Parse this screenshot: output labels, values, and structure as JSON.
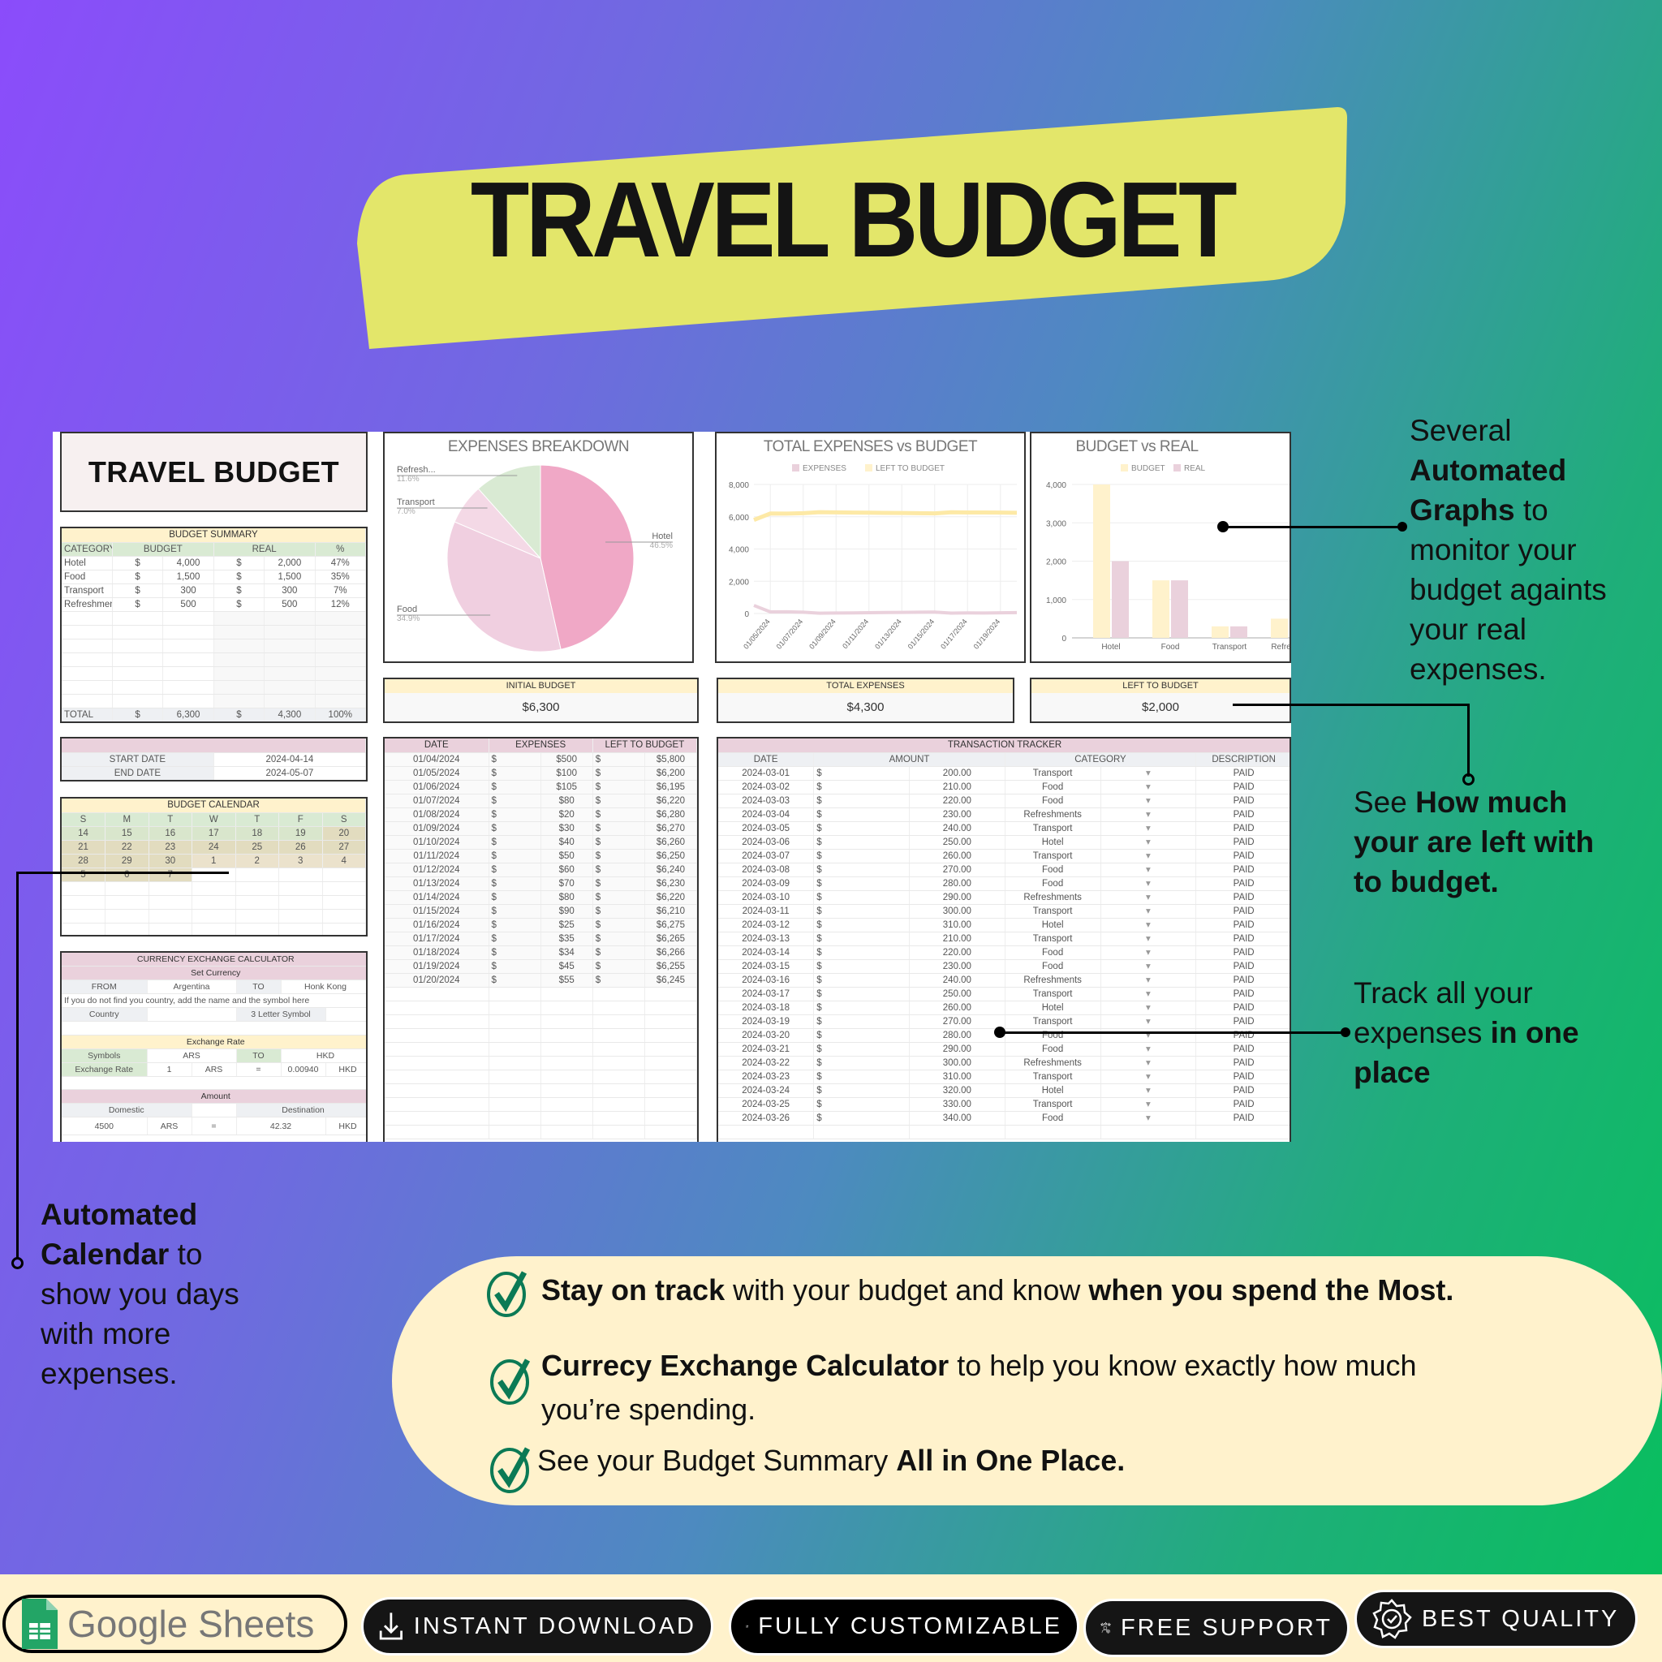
{
  "hero": {
    "title": "TRAVEL BUDGET",
    "banner_color": "#e3e66a"
  },
  "sheet": {
    "title": "TRAVEL BUDGET",
    "summary": {
      "header": "BUDGET SUMMARY",
      "columns": [
        "CATEGORY",
        "BUDGET",
        "REAL",
        "%"
      ],
      "rows": [
        [
          "Hotel",
          "$",
          "4,000",
          "$",
          "2,000",
          "47%"
        ],
        [
          "Food",
          "$",
          "1,500",
          "$",
          "1,500",
          "35%"
        ],
        [
          "Transport",
          "$",
          "300",
          "$",
          "300",
          "7%"
        ],
        [
          "Refreshments",
          "$",
          "500",
          "$",
          "500",
          "12%"
        ]
      ],
      "total": [
        "TOTAL",
        "$",
        "6,300",
        "$",
        "4,300",
        "100%"
      ]
    },
    "dates": {
      "start_label": "START DATE",
      "start": "2024-04-14",
      "end_label": "END DATE",
      "end": "2024-05-07"
    },
    "calendar": {
      "header": "BUDGET CALENDAR",
      "days": [
        "S",
        "M",
        "T",
        "W",
        "T",
        "F",
        "S"
      ],
      "weeks": [
        [
          "14",
          "15",
          "16",
          "17",
          "18",
          "19",
          "20"
        ],
        [
          "21",
          "22",
          "23",
          "24",
          "25",
          "26",
          "27"
        ],
        [
          "28",
          "29",
          "30",
          "1",
          "2",
          "3",
          "4"
        ],
        [
          "5",
          "6",
          "7",
          "",
          "",
          "",
          ""
        ]
      ]
    },
    "currency": {
      "header": "CURRENCY EXCHANGE CALCULATOR",
      "set_currency": "Set Currency",
      "from_label": "FROM",
      "from": "Argentina",
      "to_label": "TO",
      "to": "Honk Kong",
      "note": "If you do not find you country, add the name and the symbol here",
      "country_label": "Country",
      "symbol_label": "3 Letter Symbol",
      "rate_header": "Exchange Rate",
      "symbols_label": "Symbols",
      "from_symbol": "ARS",
      "to_symbol": "HKD",
      "rate_label": "Exchange Rate",
      "rate_one": "1",
      "equals": "=",
      "rate_value": "0.00940",
      "amount_header": "Amount",
      "domestic_label": "Domestic",
      "destination_label": "Destination",
      "domestic_value": "4500",
      "destination_value": "42.32"
    },
    "kpis": [
      {
        "label": "INITIAL BUDGET",
        "value": "$6,300"
      },
      {
        "label": "TOTAL EXPENSES",
        "value": "$4,300"
      },
      {
        "label": "LEFT TO BUDGET",
        "value": "$2,000"
      }
    ],
    "expenses": {
      "columns": [
        "DATE",
        "EXPENSES",
        "LEFT TO BUDGET"
      ],
      "rows": [
        [
          "01/04/2024",
          "$",
          "$500",
          "$",
          "$5,800"
        ],
        [
          "01/05/2024",
          "$",
          "$100",
          "$",
          "$6,200"
        ],
        [
          "01/06/2024",
          "$",
          "$105",
          "$",
          "$6,195"
        ],
        [
          "01/07/2024",
          "$",
          "$80",
          "$",
          "$6,220"
        ],
        [
          "01/08/2024",
          "$",
          "$20",
          "$",
          "$6,280"
        ],
        [
          "01/09/2024",
          "$",
          "$30",
          "$",
          "$6,270"
        ],
        [
          "01/10/2024",
          "$",
          "$40",
          "$",
          "$6,260"
        ],
        [
          "01/11/2024",
          "$",
          "$50",
          "$",
          "$6,250"
        ],
        [
          "01/12/2024",
          "$",
          "$60",
          "$",
          "$6,240"
        ],
        [
          "01/13/2024",
          "$",
          "$70",
          "$",
          "$6,230"
        ],
        [
          "01/14/2024",
          "$",
          "$80",
          "$",
          "$6,220"
        ],
        [
          "01/15/2024",
          "$",
          "$90",
          "$",
          "$6,210"
        ],
        [
          "01/16/2024",
          "$",
          "$25",
          "$",
          "$6,275"
        ],
        [
          "01/17/2024",
          "$",
          "$35",
          "$",
          "$6,265"
        ],
        [
          "01/18/2024",
          "$",
          "$34",
          "$",
          "$6,266"
        ],
        [
          "01/19/2024",
          "$",
          "$45",
          "$",
          "$6,255"
        ],
        [
          "01/20/2024",
          "$",
          "$55",
          "$",
          "$6,245"
        ]
      ]
    },
    "tracker": {
      "header": "TRANSACTION TRACKER",
      "columns": [
        "DATE",
        "AMOUNT",
        "CATEGORY",
        "DESCRIPTION"
      ],
      "rows": [
        [
          "2024-03-01",
          "$",
          "200.00",
          "Transport",
          "PAID"
        ],
        [
          "2024-03-02",
          "$",
          "210.00",
          "Food",
          "PAID"
        ],
        [
          "2024-03-03",
          "$",
          "220.00",
          "Food",
          "PAID"
        ],
        [
          "2024-03-04",
          "$",
          "230.00",
          "Refreshments",
          "PAID"
        ],
        [
          "2024-03-05",
          "$",
          "240.00",
          "Transport",
          "PAID"
        ],
        [
          "2024-03-06",
          "$",
          "250.00",
          "Hotel",
          "PAID"
        ],
        [
          "2024-03-07",
          "$",
          "260.00",
          "Transport",
          "PAID"
        ],
        [
          "2024-03-08",
          "$",
          "270.00",
          "Food",
          "PAID"
        ],
        [
          "2024-03-09",
          "$",
          "280.00",
          "Food",
          "PAID"
        ],
        [
          "2024-03-10",
          "$",
          "290.00",
          "Refreshments",
          "PAID"
        ],
        [
          "2024-03-11",
          "$",
          "300.00",
          "Transport",
          "PAID"
        ],
        [
          "2024-03-12",
          "$",
          "310.00",
          "Hotel",
          "PAID"
        ],
        [
          "2024-03-13",
          "$",
          "210.00",
          "Transport",
          "PAID"
        ],
        [
          "2024-03-14",
          "$",
          "220.00",
          "Food",
          "PAID"
        ],
        [
          "2024-03-15",
          "$",
          "230.00",
          "Food",
          "PAID"
        ],
        [
          "2024-03-16",
          "$",
          "240.00",
          "Refreshments",
          "PAID"
        ],
        [
          "2024-03-17",
          "$",
          "250.00",
          "Transport",
          "PAID"
        ],
        [
          "2024-03-18",
          "$",
          "260.00",
          "Hotel",
          "PAID"
        ],
        [
          "2024-03-19",
          "$",
          "270.00",
          "Transport",
          "PAID"
        ],
        [
          "2024-03-20",
          "$",
          "280.00",
          "Food",
          "PAID"
        ],
        [
          "2024-03-21",
          "$",
          "290.00",
          "Food",
          "PAID"
        ],
        [
          "2024-03-22",
          "$",
          "300.00",
          "Refreshments",
          "PAID"
        ],
        [
          "2024-03-23",
          "$",
          "310.00",
          "Transport",
          "PAID"
        ],
        [
          "2024-03-24",
          "$",
          "320.00",
          "Hotel",
          "PAID"
        ],
        [
          "2024-03-25",
          "$",
          "330.00",
          "Transport",
          "PAID"
        ],
        [
          "2024-03-26",
          "$",
          "340.00",
          "Food",
          "PAID"
        ]
      ]
    }
  },
  "chart_data": [
    {
      "type": "pie",
      "title": "EXPENSES BREAKDOWN",
      "labels": [
        "Hotel",
        "Food",
        "Transport",
        "Refresh..."
      ],
      "label_values": [
        "46.5%",
        "34.9%",
        "7.0%",
        "11.6%"
      ],
      "values": [
        46.5,
        34.9,
        7.0,
        11.6
      ],
      "colors": [
        "#f0a8c6",
        "#f0cfe0",
        "#f4d9e6",
        "#d9ead3"
      ]
    },
    {
      "type": "line",
      "title": "TOTAL EXPENSES vs BUDGET",
      "legend": [
        "EXPENSES",
        "LEFT TO BUDGET"
      ],
      "legend_placement": "top",
      "colors": [
        "#ead1dc",
        "#fff2cc"
      ],
      "ylim": [
        0,
        8000
      ],
      "yticks": [
        "0",
        "2,000",
        "4,000",
        "6,000",
        "8,000"
      ],
      "xticks": [
        "01/05/2024",
        "01/07/2024",
        "01/09/2024",
        "01/11/2024",
        "01/13/2024",
        "01/15/2024",
        "01/17/2024",
        "01/19/2024"
      ],
      "x": [
        "01/04/2024",
        "01/05/2024",
        "01/06/2024",
        "01/07/2024",
        "01/08/2024",
        "01/09/2024",
        "01/10/2024",
        "01/11/2024",
        "01/12/2024",
        "01/13/2024",
        "01/14/2024",
        "01/15/2024",
        "01/16/2024",
        "01/17/2024",
        "01/18/2024",
        "01/19/2024",
        "01/20/2024"
      ],
      "series": [
        {
          "name": "EXPENSES",
          "values": [
            500,
            100,
            105,
            80,
            20,
            30,
            40,
            50,
            60,
            70,
            80,
            90,
            25,
            35,
            34,
            45,
            55
          ]
        },
        {
          "name": "LEFT TO BUDGET",
          "values": [
            5800,
            6200,
            6195,
            6220,
            6280,
            6270,
            6260,
            6250,
            6240,
            6230,
            6220,
            6210,
            6275,
            6265,
            6266,
            6255,
            6245
          ]
        }
      ],
      "grid": true
    },
    {
      "type": "bar",
      "title": "BUDGET vs REAL",
      "legend": [
        "BUDGET",
        "REAL"
      ],
      "legend_placement": "top",
      "colors": [
        "#fff2cc",
        "#ead1dc"
      ],
      "categories": [
        "Hotel",
        "Food",
        "Transport",
        "Refresh..."
      ],
      "ylim": [
        0,
        4000
      ],
      "yticks": [
        "0",
        "1,000",
        "2,000",
        "3,000",
        "4,000"
      ],
      "series": [
        {
          "name": "BUDGET",
          "values": [
            4000,
            1500,
            300,
            500
          ]
        },
        {
          "name": "REAL",
          "values": [
            2000,
            1500,
            300,
            500
          ]
        }
      ],
      "grid": true
    }
  ],
  "annotations": {
    "graphs": [
      "Several",
      "Automated",
      "Graphs",
      " to",
      "monitor your",
      "budget againts",
      "your real",
      "expenses."
    ],
    "left": [
      "See ",
      "How much",
      "your are left with",
      "to budget."
    ],
    "track": [
      "Track all your",
      "expenses ",
      "in one",
      "place"
    ],
    "calendar": [
      "Automated",
      "Calendar",
      "  to",
      "show you days",
      "with more",
      "expenses."
    ]
  },
  "features": [
    {
      "bold1": "Stay on track",
      "text": " with your budget and know ",
      "bold2": "when you spend the Most."
    },
    {
      "bold1": "Currecy Exchange Calculator",
      "text": "  to help you know exactly how much",
      "text2": "you’re spending."
    },
    {
      "text": "See your Budget Summary  ",
      "bold2": "All in One Place."
    }
  ],
  "badges": {
    "google": "Google Sheets",
    "download": "INSTANT DOWNLOAD",
    "custom": "FULLY CUSTOMIZABLE",
    "support": "FREE SUPPORT",
    "quality": "BEST QUALITY"
  },
  "colors": {
    "accent_green": "#0b7a55",
    "cream": "#fff2cc"
  }
}
